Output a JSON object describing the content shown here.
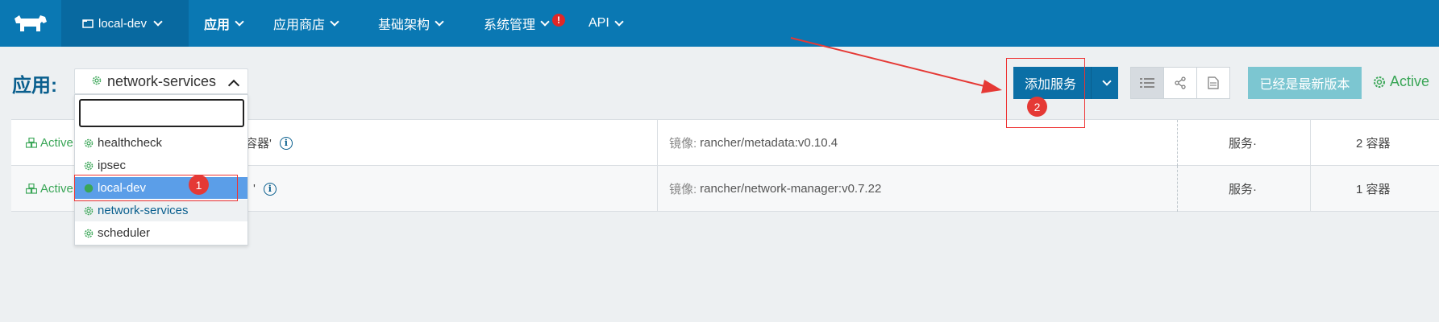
{
  "nav": {
    "environment": "local-dev",
    "items": [
      {
        "label": "应用",
        "active": true
      },
      {
        "label": "应用商店",
        "active": false
      },
      {
        "label": "基础架构",
        "active": false
      },
      {
        "label": "系统管理",
        "active": false,
        "alert": "!"
      },
      {
        "label": "API",
        "active": false
      }
    ]
  },
  "header": {
    "page_label": "应用:",
    "stack_selected": "network-services",
    "add_service_label": "添加服务",
    "up_to_date_label": "已经是最新版本",
    "state": "Active"
  },
  "dropdown": {
    "search_value": "",
    "options": [
      {
        "label": "healthcheck",
        "state": "normal"
      },
      {
        "label": "ipsec",
        "state": "normal"
      },
      {
        "label": "local-dev",
        "state": "selected"
      },
      {
        "label": "network-services",
        "state": "hover"
      },
      {
        "label": "scheduler",
        "state": "normal"
      }
    ]
  },
  "table": {
    "rows": [
      {
        "state": "Active",
        "desc_tail": "容器'",
        "image_label": "镜像:",
        "image": "rancher/metadata:v0.10.4",
        "services": "服务·",
        "containers": "2 容器"
      },
      {
        "state": "Active",
        "desc_tail": "'",
        "image_label": "镜像:",
        "image": "rancher/network-manager:v0.7.22",
        "services": "服务·",
        "containers": "1 容器"
      }
    ]
  },
  "annotations": {
    "marker_1": "1",
    "marker_2": "2"
  },
  "colors": {
    "nav_bg": "#0a78b3",
    "primary_button": "#0b6fa6",
    "active_green": "#3aa657",
    "annotation_red": "#e53935"
  }
}
